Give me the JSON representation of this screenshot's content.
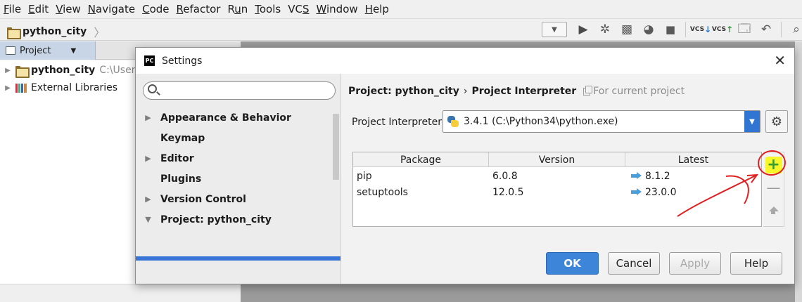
{
  "menu": [
    {
      "label": "File",
      "u": "F",
      "rest": "ile"
    },
    {
      "label": "Edit",
      "u": "E",
      "rest": "dit"
    },
    {
      "label": "View",
      "u": "V",
      "rest": "iew"
    },
    {
      "label": "Navigate",
      "u": "N",
      "rest": "avigate"
    },
    {
      "label": "Code",
      "u": "C",
      "rest": "ode"
    },
    {
      "label": "Refactor",
      "u": "R",
      "rest": "efactor"
    },
    {
      "label": "Run",
      "pre": "R",
      "u": "u",
      "rest": "n"
    },
    {
      "label": "Tools",
      "u": "T",
      "rest": "ools"
    },
    {
      "label": "VCS",
      "pre": "VC",
      "u": "S",
      "rest": ""
    },
    {
      "label": "Window",
      "u": "W",
      "rest": "indow"
    },
    {
      "label": "Help",
      "u": "H",
      "rest": "elp"
    }
  ],
  "navbar": {
    "project": "python_city"
  },
  "toolbar": {
    "vcs1": "VCS",
    "vcs2": "VCS"
  },
  "project_panel": {
    "tab_label": "Project",
    "tree": [
      {
        "name": "python_city",
        "path": "C:\\Users"
      },
      {
        "name": "External Libraries"
      }
    ]
  },
  "dialog": {
    "title": "Settings",
    "close": "✕",
    "search_placeholder": "",
    "nav": [
      {
        "label": "Appearance & Behavior",
        "toggle": "▶"
      },
      {
        "label": "Keymap",
        "toggle": ""
      },
      {
        "label": "Editor",
        "toggle": "▶"
      },
      {
        "label": "Plugins",
        "toggle": ""
      },
      {
        "label": "Version Control",
        "toggle": "▶"
      },
      {
        "label": "Project: python_city",
        "toggle": "▼"
      }
    ],
    "breadcrumb": {
      "part1": "Project: python_city",
      "separator": "›",
      "part2": "Project Interpreter",
      "scope": "For current project"
    },
    "interpreter": {
      "label": "Project Interpreter:",
      "value": "3.4.1 (C:\\Python34\\python.exe)"
    },
    "table": {
      "headers": [
        "Package",
        "Version",
        "Latest"
      ],
      "rows": [
        {
          "package": "pip",
          "version": "6.0.8",
          "latest": "8.1.2"
        },
        {
          "package": "setuptools",
          "version": "12.0.5",
          "latest": "23.0.0"
        }
      ]
    },
    "side_buttons": {
      "add": "+",
      "remove": "—"
    },
    "buttons": {
      "ok": "OK",
      "cancel": "Cancel",
      "apply": "Apply",
      "help": "Help"
    }
  },
  "colors": {
    "accent": "#3875d7",
    "highlight": "#f6f62a",
    "annotation": "#e02020",
    "add_green": "#3c9b2c"
  }
}
